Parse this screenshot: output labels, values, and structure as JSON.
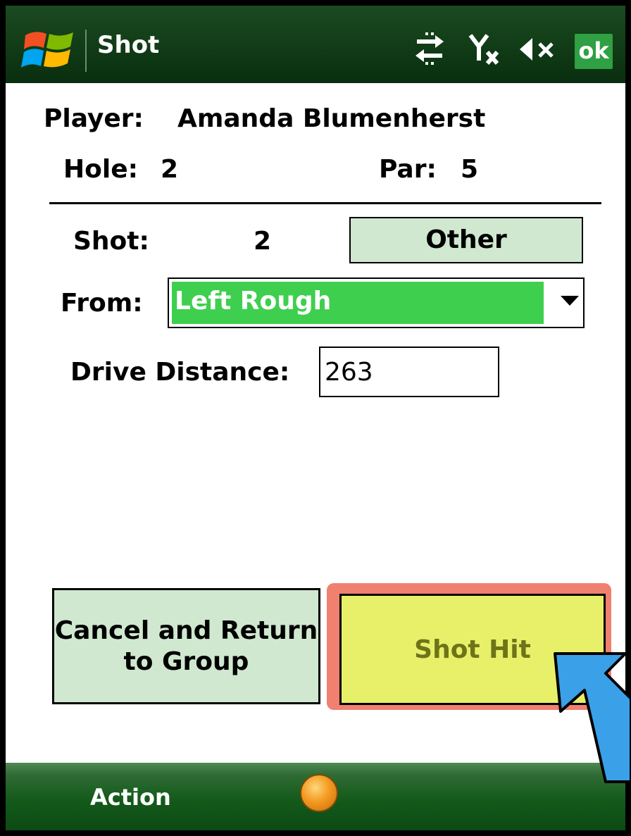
{
  "titlebar": {
    "title": "Shot",
    "ok_label": "ok",
    "icons": [
      "windows-logo-icon",
      "connectivity-icon",
      "signal-off-icon",
      "volume-muted-icon"
    ]
  },
  "player": {
    "label": "Player:",
    "value": "Amanda Blumenherst"
  },
  "hole": {
    "label": "Hole:",
    "value": "2"
  },
  "par": {
    "label": "Par:",
    "value": "5"
  },
  "shot": {
    "label": "Shot:",
    "value": "2",
    "button_label": "Other"
  },
  "from": {
    "label": "From:",
    "selected": "Left Rough"
  },
  "drive_distance": {
    "label": "Drive Distance:",
    "value": "263"
  },
  "buttons": {
    "cancel": "Cancel and Return to Group",
    "shot_hit": "Shot Hit"
  },
  "bottombar": {
    "action_label": "Action"
  },
  "colors": {
    "titlebar": "#0f3a15",
    "ok_bg": "#2fa043",
    "button_green": "#cfe8cf",
    "selected_green": "#3fcf4f",
    "shot_hit_bg": "#e8f06a",
    "highlight": "#f08070",
    "pointer_arrow": "#3aa0e8"
  }
}
